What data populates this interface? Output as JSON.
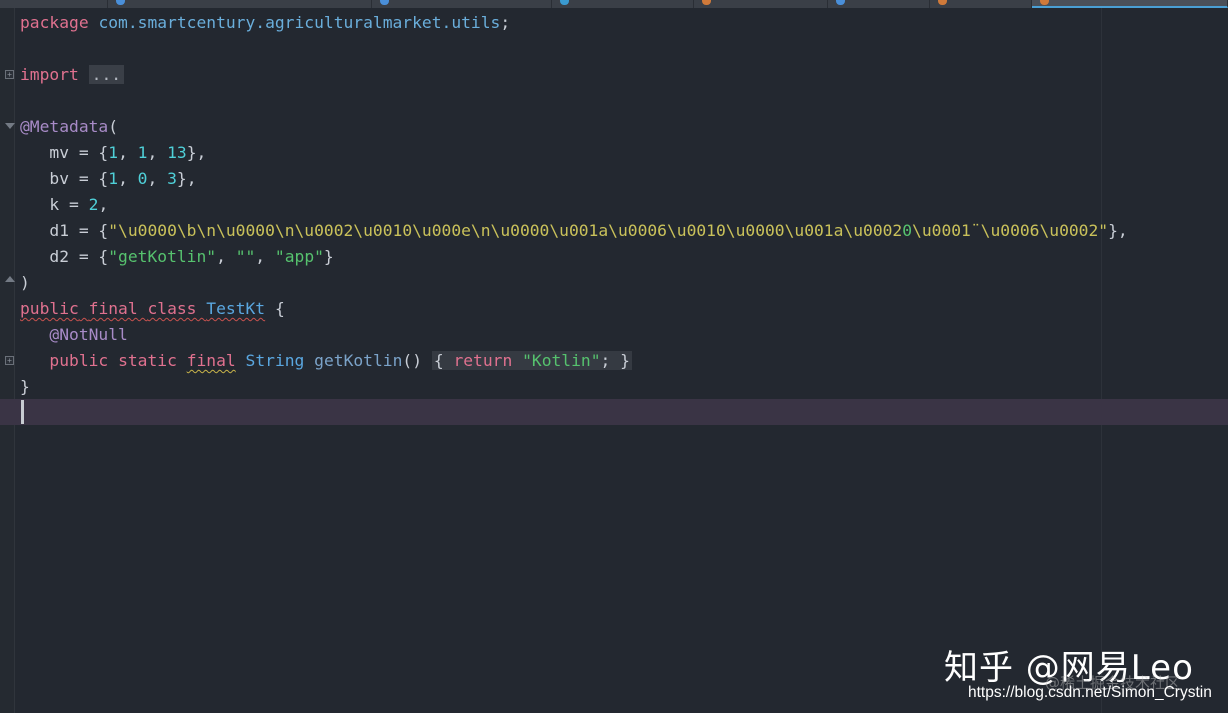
{
  "editor": {
    "tabs": [
      {
        "icon_color": "#4a8fd9",
        "active": false
      },
      {
        "icon_color": "#4a8fd9",
        "active": false
      },
      {
        "icon_color": "#4a8fd9",
        "active": false
      },
      {
        "icon_color": "#3a9ad0",
        "active": false
      },
      {
        "icon_color": "#d07a3a",
        "active": false
      },
      {
        "icon_color": "#4a8fd9",
        "active": false
      },
      {
        "icon_color": "#d07a3a",
        "active": false
      },
      {
        "icon_color": "#d07a3a",
        "active": true
      }
    ],
    "code": {
      "package_kw": "package",
      "package_name": "com.smartcentury.agriculturalmarket.utils",
      "semicolon": ";",
      "import_kw": "import",
      "import_folded": "...",
      "metadata_ann": "@Metadata",
      "open_paren": "(",
      "mv_key": "mv = {",
      "mv_vals": [
        "1",
        "1",
        "13"
      ],
      "bv_key": "bv = {",
      "bv_vals": [
        "1",
        "0",
        "3"
      ],
      "k_key": "k = ",
      "k_val": "2",
      "d1_key": "d1 = {",
      "d1_str_a": "\"\\u0000\\b\\n\\u0000\\n\\u0002\\u0010\\u000e\\n\\u0000\\u001a\\u0006\\u0010\\u0000\\u001a\\u0002",
      "d1_str_b": "0",
      "d1_str_c": "\\u0001¨\\u0006\\u0002\"",
      "d2_key": "d2 = {",
      "d2_vals": [
        "\"getKotlin\"",
        "\"\"",
        "\"app\""
      ],
      "close_paren": ")",
      "public_kw": "public",
      "final_kw": "final",
      "class_kw": "class",
      "class_name": "TestKt",
      "notnull_ann": "@NotNull",
      "static_kw": "static",
      "string_type": "String",
      "method_name": "getKotlin",
      "method_parens": "()",
      "return_kw": "return",
      "return_val": "\"Kotlin\"",
      "open_brace": "{",
      "close_brace": "}"
    }
  },
  "watermark": {
    "zhihu": "知乎 @网易Leo",
    "juejin": "@稀土掘金技术社区",
    "csdn": "https://blog.csdn.net/Simon_Crystin"
  }
}
